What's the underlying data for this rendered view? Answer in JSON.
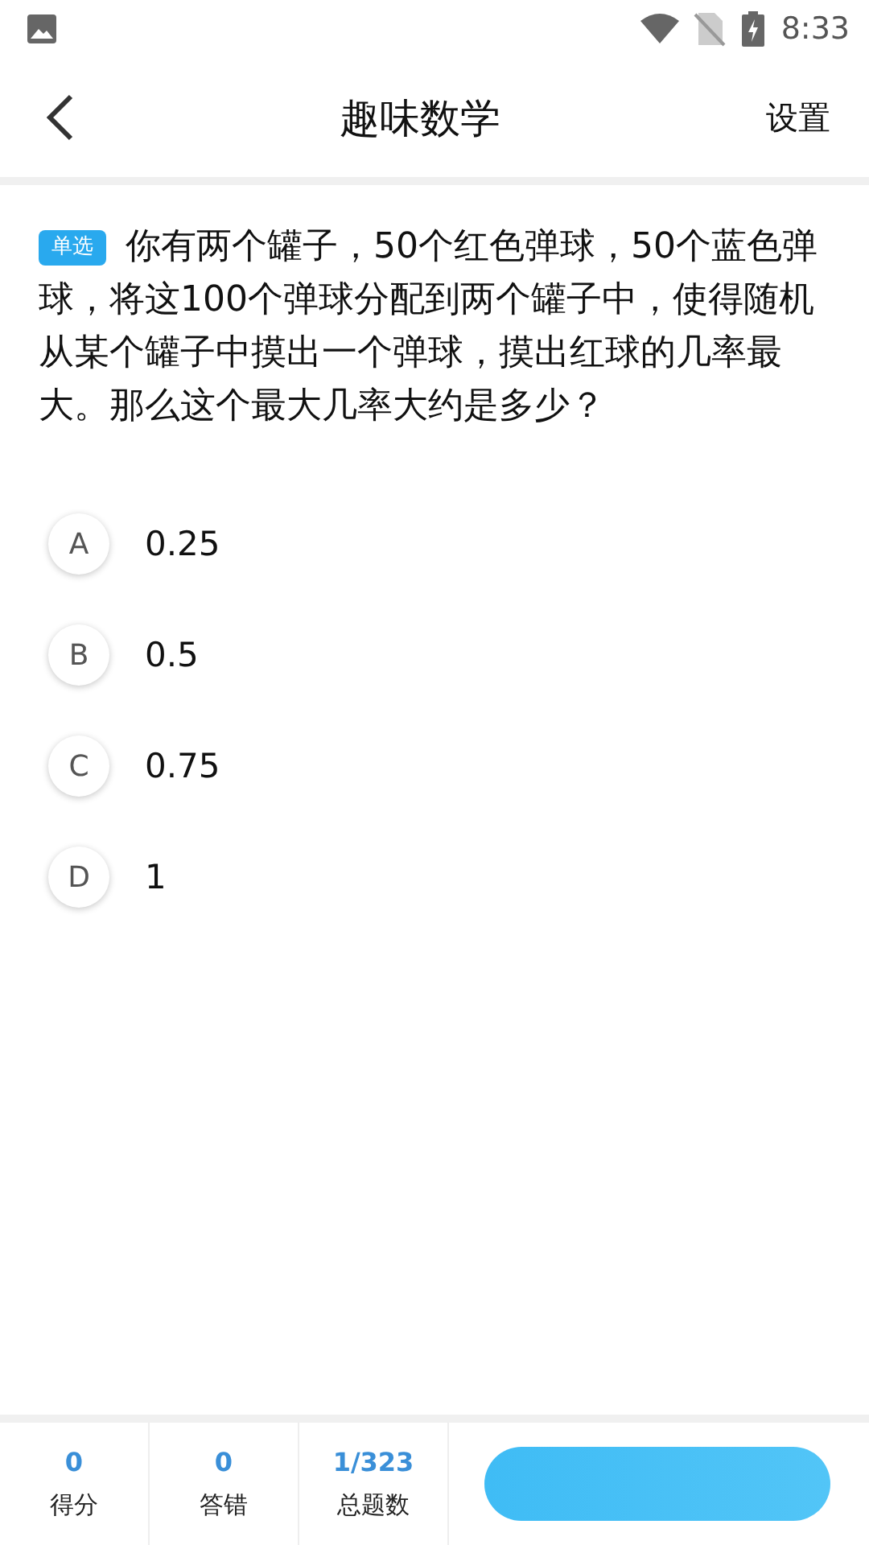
{
  "status_bar": {
    "time": "8:33"
  },
  "header": {
    "title": "趣味数学",
    "action": "设置"
  },
  "question": {
    "tag": "单选",
    "text": "你有两个罐子，50个红色弹球，50个蓝色弹球，将这100个弹球分配到两个罐子中，使得随机从某个罐子中摸出一个弹球，摸出红球的几率最大。那么这个最大几率大约是多少？"
  },
  "options": [
    {
      "letter": "A",
      "text": "0.25",
      "selected": false
    },
    {
      "letter": "B",
      "text": "0.5",
      "selected": false
    },
    {
      "letter": "C",
      "text": "0.75",
      "selected": false
    },
    {
      "letter": "D",
      "text": "1",
      "selected": false
    }
  ],
  "stats": [
    {
      "value": "0",
      "label": "得分"
    },
    {
      "value": "0",
      "label": "答错"
    },
    {
      "value": "1/323",
      "label": "总题数"
    }
  ]
}
